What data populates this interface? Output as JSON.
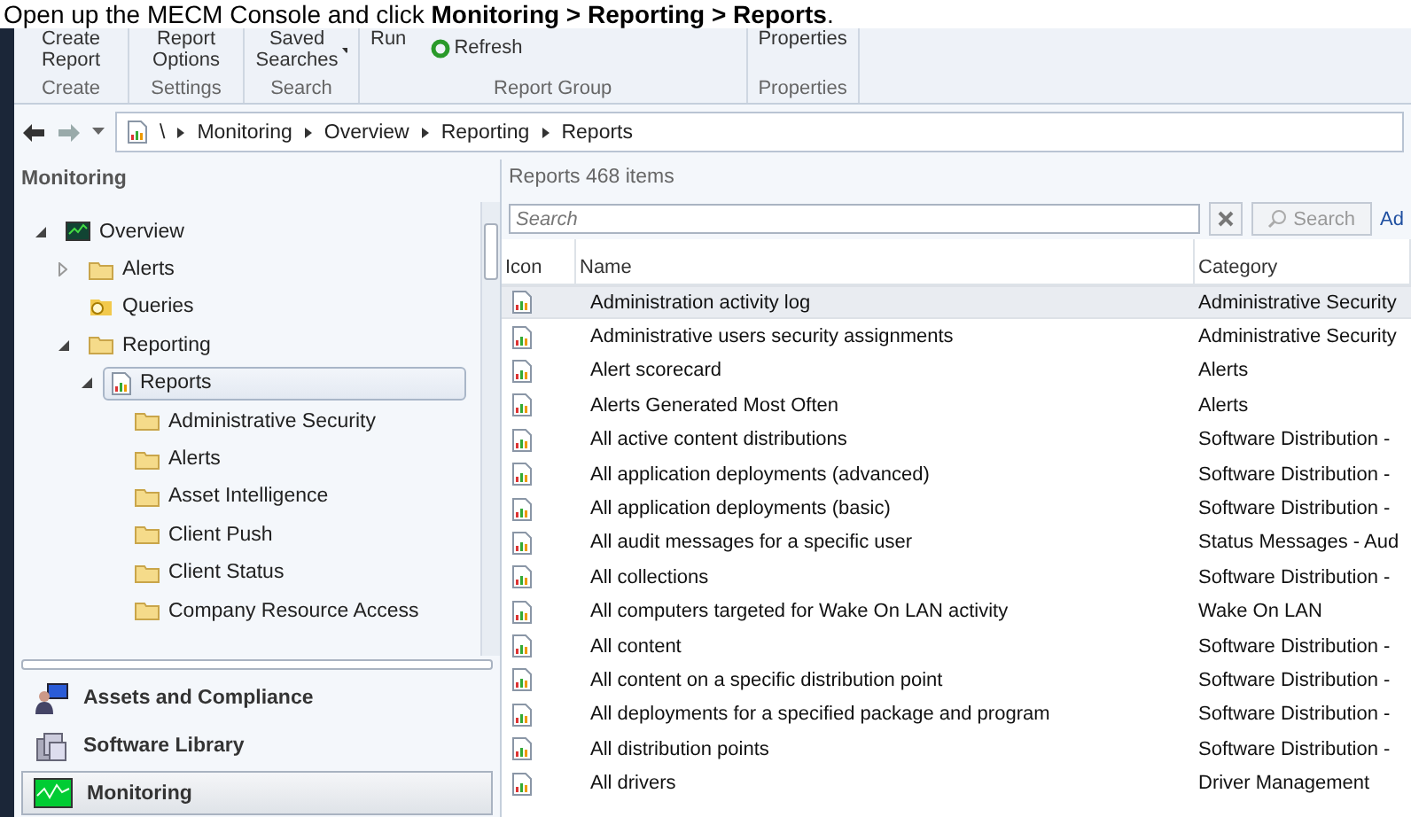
{
  "caption": "Open up the MECM Console and click **Monitoring > Reporting > Reports**.",
  "ribbon": {
    "groups": [
      {
        "label": "Create",
        "buttons": [
          {
            "label": "Create Report",
            "kind": "plain"
          }
        ]
      },
      {
        "label": "Settings",
        "buttons": [
          {
            "label": "Report Options",
            "kind": "plain"
          }
        ]
      },
      {
        "label": "Search",
        "buttons": [
          {
            "label": "Saved Searches",
            "kind": "dropdown"
          }
        ]
      },
      {
        "label": "Report Group",
        "buttons": [
          {
            "label": "Run",
            "kind": "plain"
          },
          {
            "label": "Refresh",
            "kind": "refresh"
          }
        ]
      },
      {
        "label": "Properties",
        "buttons": [
          {
            "label": "Properties",
            "kind": "plain"
          }
        ]
      }
    ]
  },
  "breadcrumb": {
    "root": "\\",
    "items": [
      "Monitoring",
      "Overview",
      "Reporting",
      "Reports"
    ]
  },
  "nav_pane": {
    "title": "Monitoring",
    "tree": [
      {
        "label": "Overview",
        "kind": "overview",
        "expanded": true,
        "selected": false,
        "children": [
          {
            "label": "Alerts",
            "kind": "folder",
            "expanded": false,
            "selected": false
          },
          {
            "label": "Queries",
            "kind": "queries",
            "selected": false
          },
          {
            "label": "Reporting",
            "kind": "folder",
            "expanded": true,
            "selected": false,
            "children": [
              {
                "label": "Reports",
                "kind": "report",
                "expanded": true,
                "selected": true,
                "children": [
                  {
                    "label": "Administrative Security",
                    "kind": "folder",
                    "selected": false
                  },
                  {
                    "label": "Alerts",
                    "kind": "folder",
                    "selected": false
                  },
                  {
                    "label": "Asset Intelligence",
                    "kind": "folder",
                    "selected": false
                  },
                  {
                    "label": "Client Push",
                    "kind": "folder",
                    "selected": false
                  },
                  {
                    "label": "Client Status",
                    "kind": "folder",
                    "selected": false
                  },
                  {
                    "label": "Company Resource Access",
                    "kind": "folder",
                    "selected": false
                  }
                ]
              }
            ]
          }
        ]
      }
    ],
    "workspaces": [
      {
        "label": "Assets and Compliance",
        "kind": "assets",
        "selected": false
      },
      {
        "label": "Software Library",
        "kind": "library",
        "selected": false
      },
      {
        "label": "Monitoring",
        "kind": "monitoring",
        "selected": true
      }
    ]
  },
  "results": {
    "title": "Reports 468 items",
    "search": {
      "placeholder": "Search",
      "button": "Search",
      "add": "Ad"
    },
    "columns": [
      "Icon",
      "Name",
      "Category"
    ],
    "rows": [
      {
        "name": "Administration activity log",
        "category": "Administrative Security",
        "selected": true
      },
      {
        "name": "Administrative users security assignments",
        "category": "Administrative Security",
        "selected": false
      },
      {
        "name": "Alert scorecard",
        "category": "Alerts",
        "selected": false
      },
      {
        "name": "Alerts Generated Most Often",
        "category": "Alerts",
        "selected": false
      },
      {
        "name": "All active content distributions",
        "category": "Software Distribution -",
        "selected": false
      },
      {
        "name": "All application deployments (advanced)",
        "category": "Software Distribution -",
        "selected": false
      },
      {
        "name": "All application deployments (basic)",
        "category": "Software Distribution -",
        "selected": false
      },
      {
        "name": "All audit messages for a specific user",
        "category": "Status Messages - Aud",
        "selected": false
      },
      {
        "name": "All collections",
        "category": "Software Distribution -",
        "selected": false
      },
      {
        "name": "All computers targeted for Wake On LAN activity",
        "category": "Wake On LAN",
        "selected": false
      },
      {
        "name": "All content",
        "category": "Software Distribution -",
        "selected": false
      },
      {
        "name": "All content on a specific distribution point",
        "category": "Software Distribution -",
        "selected": false
      },
      {
        "name": "All deployments for a specified package and program",
        "category": "Software Distribution -",
        "selected": false
      },
      {
        "name": "All distribution points",
        "category": "Software Distribution -",
        "selected": false
      },
      {
        "name": "All drivers",
        "category": "Driver Management",
        "selected": false
      }
    ]
  }
}
